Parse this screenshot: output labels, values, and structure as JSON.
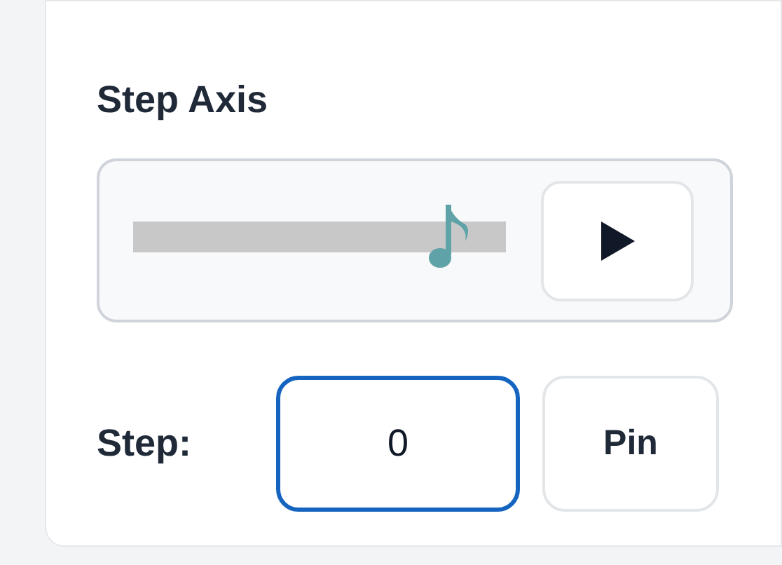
{
  "panel": {
    "title": "Step Axis"
  },
  "slider": {
    "level": 0.9
  },
  "step": {
    "label": "Step:",
    "value": "0"
  },
  "pin_button": {
    "label": "Pin"
  }
}
